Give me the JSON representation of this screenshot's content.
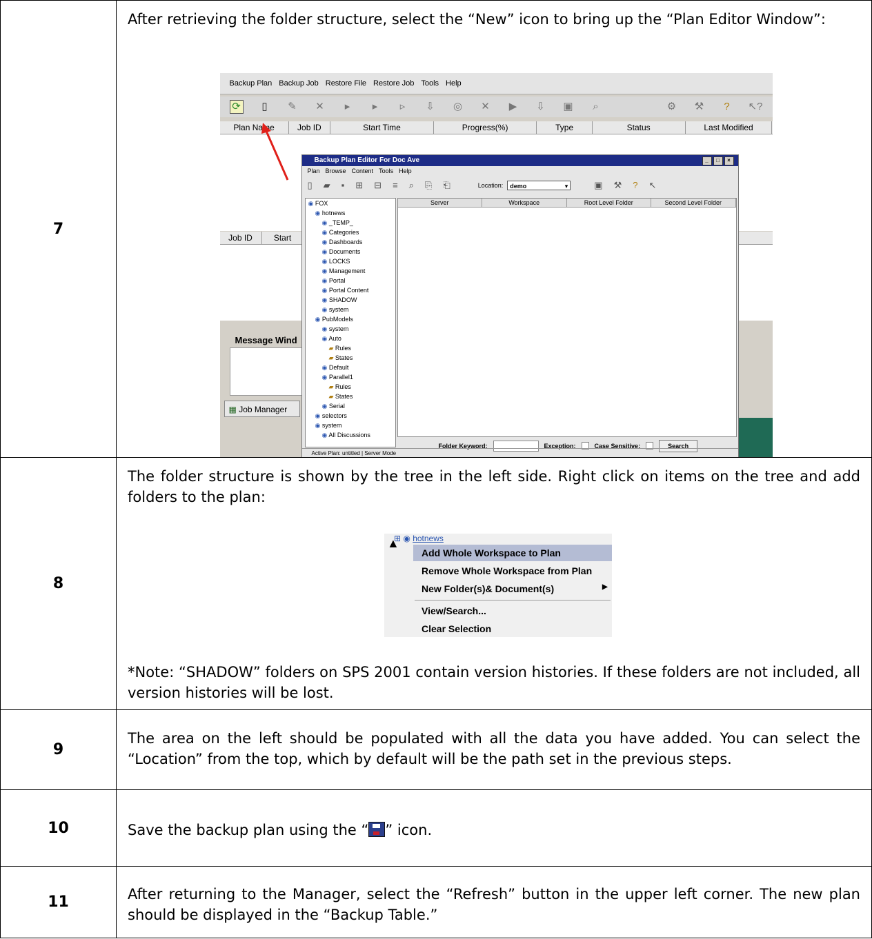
{
  "rows": [
    {
      "step": "7",
      "text": "After retrieving the folder structure, select the “New” icon to bring up the “Plan Editor Window”:"
    },
    {
      "step": "8",
      "text": "The folder structure is shown by the tree in the left side. Right click on items on the tree and add folders to the plan:",
      "note": "*Note: “SHADOW” folders on SPS 2001 contain version histories. If these folders are not included, all version histories will be lost."
    },
    {
      "step": "9",
      "text": "The area on the left should be populated with all the data you have added. You can select the “Location” from the top, which by default will be the path set in the previous steps."
    },
    {
      "step": "10",
      "text_before": "Save the backup plan using the “",
      "text_after": "” icon."
    },
    {
      "step": "11",
      "text": "After returning to the Manager, select the “Refresh” button in the upper left corner. The new plan should be displayed in the “Backup Table.”"
    }
  ],
  "screenshot": {
    "menu": [
      "Backup Plan",
      "Backup Job",
      "Restore File",
      "Restore Job",
      "Tools",
      "Help"
    ],
    "columns": [
      "Plan Name",
      "Job ID",
      "Start Time",
      "Progress(%)",
      "Type",
      "Status",
      "Last Modified"
    ],
    "lower_columns": [
      "Job ID",
      "Start"
    ],
    "message_window": "Message Wind",
    "job_manager": "Job Manager",
    "dialog": {
      "title": "Backup Plan Editor For Doc Ave",
      "menu": [
        "Plan",
        "Browse",
        "Content",
        "Tools",
        "Help"
      ],
      "location_label": "Location:",
      "location_value": "demo",
      "grid_columns": [
        "Server",
        "Workspace",
        "Root Level Folder",
        "Second Level Folder"
      ],
      "tree": [
        "FOX",
        "hotnews",
        "_TEMP_",
        "Categories",
        "Dashboards",
        "Documents",
        "LOCKS",
        "Management",
        "Portal",
        "Portal Content",
        "SHADOW",
        "system",
        "PubModels",
        "system",
        "Auto",
        "Rules",
        "States",
        "Default",
        "Parallel1",
        "Rules",
        "States",
        "Serial",
        "selectors",
        "system",
        "All Discussions"
      ],
      "folder_keyword": "Folder Keyword:",
      "exception": "Exception:",
      "case_sensitive": "Case Sensitive:",
      "search": "Search",
      "status": "Active Plan: untitled  |  Server Mode"
    }
  },
  "context_menu": {
    "node": "hotnews",
    "items": [
      "Add Whole Workspace to Plan",
      "Remove Whole Workspace from Plan",
      "New Folder(s)& Document(s)",
      "View/Search...",
      "Clear Selection"
    ]
  }
}
